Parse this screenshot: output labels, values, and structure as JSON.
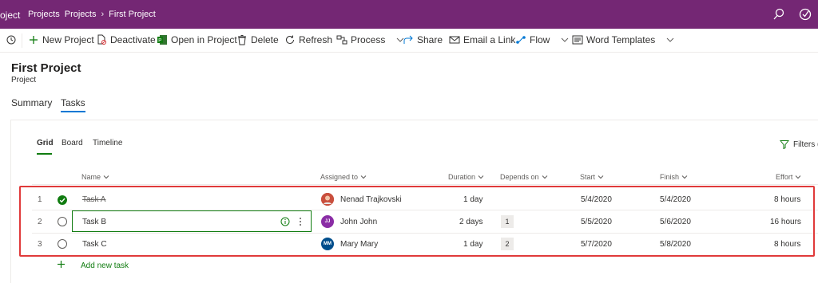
{
  "colors": {
    "brand": "#742774",
    "accent": "#107c10",
    "link": "#0078d4",
    "highlight": "#e03a3a"
  },
  "topbar": {
    "app_name": "oject",
    "breadcrumbs": [
      "Projects",
      "Projects",
      "First Project"
    ],
    "icons": [
      "search-icon",
      "checkmark-circle-icon"
    ]
  },
  "commands": [
    {
      "label": "",
      "icon": "history-icon"
    },
    {
      "label": "New Project",
      "icon": "plus-icon"
    },
    {
      "label": "Deactivate",
      "icon": "document-blocked-icon"
    },
    {
      "label": "Open in Project",
      "icon": "project-icon"
    },
    {
      "label": "Delete",
      "icon": "trash-icon"
    },
    {
      "label": "Refresh",
      "icon": "refresh-icon"
    },
    {
      "label": "Process",
      "icon": "process-icon"
    },
    {
      "label": "Share",
      "icon": "share-icon"
    },
    {
      "label": "Email a Link",
      "icon": "mail-icon"
    },
    {
      "label": "Flow",
      "icon": "flow-icon"
    },
    {
      "label": "Word Templates",
      "icon": "word-icon"
    }
  ],
  "header": {
    "title": "First Project",
    "subtitle": "Project"
  },
  "form_tabs": [
    {
      "label": "Summary",
      "active": false
    },
    {
      "label": "Tasks",
      "active": true
    }
  ],
  "sub_tabs": [
    {
      "label": "Grid",
      "active": true
    },
    {
      "label": "Board",
      "active": false
    },
    {
      "label": "Timeline",
      "active": false
    }
  ],
  "filters_label": "Filters (",
  "columns": [
    "Name",
    "Assigned to",
    "Duration",
    "Depends on",
    "Start",
    "Finish",
    "Effort"
  ],
  "tasks": [
    {
      "num": "1",
      "name": "Task A",
      "completed": true,
      "assignee": "Nenad Trajkovski",
      "initials": "",
      "avatar_color": "#c94f3d",
      "duration": "1 day",
      "depends_on": "",
      "start": "5/4/2020",
      "finish": "5/4/2020",
      "effort": "8 hours"
    },
    {
      "num": "2",
      "name": "Task B",
      "completed": false,
      "assignee": "John John",
      "initials": "JJ",
      "avatar_color": "#8a2da5",
      "duration": "2 days",
      "depends_on": "1",
      "start": "5/5/2020",
      "finish": "5/6/2020",
      "effort": "16 hours"
    },
    {
      "num": "3",
      "name": "Task C",
      "completed": false,
      "assignee": "Mary Mary",
      "initials": "MM",
      "avatar_color": "#004e8c",
      "duration": "1 day",
      "depends_on": "2",
      "start": "5/7/2020",
      "finish": "5/8/2020",
      "effort": "8 hours"
    }
  ],
  "add_task_label": "Add new task"
}
